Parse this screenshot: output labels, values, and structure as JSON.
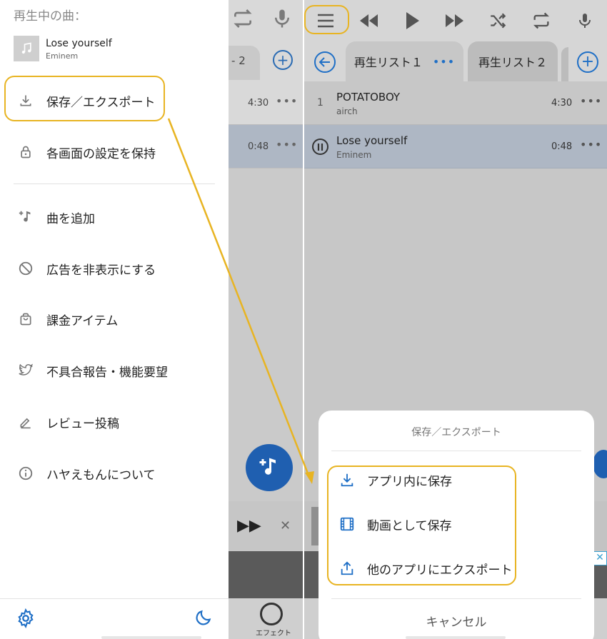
{
  "drawer": {
    "now_playing_label": "再生中の曲：",
    "now_playing": {
      "title": "Lose yourself",
      "artist": "Eminem"
    },
    "items": [
      {
        "label": "保存／エクスポート",
        "icon": "download-icon"
      },
      {
        "label": "各画面の設定を保持",
        "icon": "lock-icon"
      },
      {
        "label": "曲を追加",
        "icon": "add-music-icon"
      },
      {
        "label": "広告を非表示にする",
        "icon": "block-icon"
      },
      {
        "label": "課金アイテム",
        "icon": "shopping-bag-icon"
      },
      {
        "label": "不具合報告・機能要望",
        "icon": "twitter-icon"
      },
      {
        "label": "レビュー投稿",
        "icon": "edit-icon"
      },
      {
        "label": "ハヤえもんについて",
        "icon": "info-icon"
      }
    ]
  },
  "behind": {
    "tab_partial": "2",
    "rows": [
      {
        "time": "4:30"
      },
      {
        "time": "0:48"
      }
    ]
  },
  "right": {
    "tabs": [
      {
        "label": "再生リスト１"
      },
      {
        "label": "再生リスト２"
      }
    ],
    "songs": [
      {
        "index": "1",
        "title": "POTATOBOY",
        "artist": "airch",
        "time": "4:30"
      },
      {
        "title": "Lose yourself",
        "artist": "Eminem",
        "time": "0:48"
      }
    ],
    "sheet": {
      "title": "保存／エクスポート",
      "options": [
        {
          "label": "アプリ内に保存",
          "icon": "download-icon"
        },
        {
          "label": "動画として保存",
          "icon": "film-icon"
        },
        {
          "label": "他のアプリにエクスポート",
          "icon": "share-icon"
        }
      ],
      "cancel": "キャンセル"
    },
    "effect_label": "エフェクト"
  },
  "colors": {
    "accent": "#1f6fc6",
    "highlight": "#e8b422",
    "fab": "#1f6fc6"
  }
}
